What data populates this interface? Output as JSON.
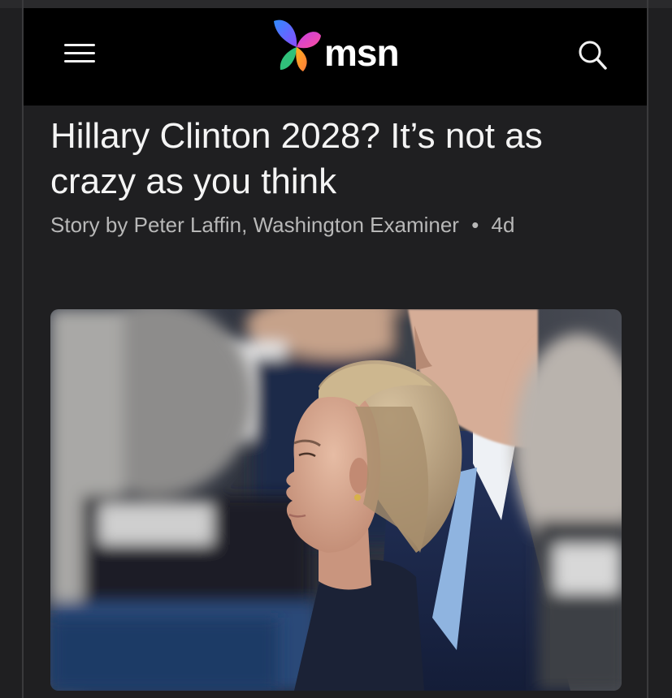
{
  "header": {
    "brand": "msn",
    "menu_icon": "hamburger-menu-icon",
    "search_icon": "search-icon"
  },
  "article": {
    "headline": "Hillary Clinton 2028? It’s not as crazy as you think",
    "byline": {
      "prefix": "Story by",
      "author": "Peter Laffin",
      "publication": "Washington Examiner",
      "age": "4d"
    },
    "image_alt": "Hillary Clinton in profile among a crowd"
  },
  "colors": {
    "background": "#1f1f21",
    "header": "#000000",
    "text": "#f4f4f4",
    "meta_text": "#b8b8b8"
  }
}
